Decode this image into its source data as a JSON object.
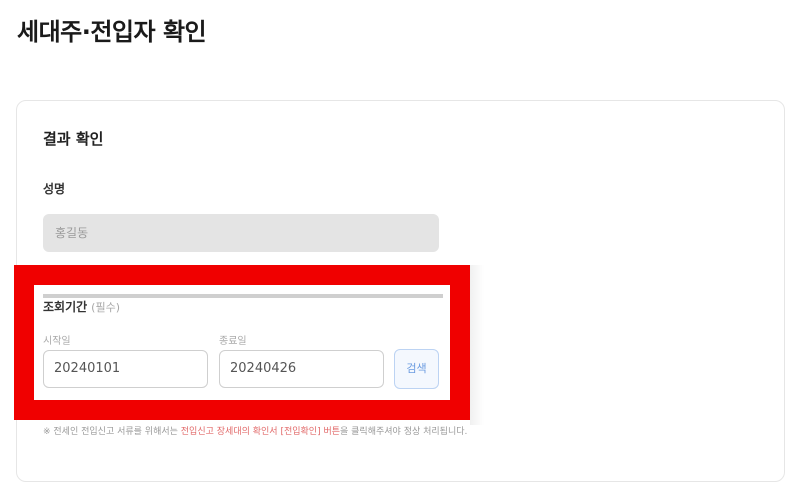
{
  "page": {
    "title": "세대주·전입자 확인"
  },
  "result": {
    "section_title": "결과 확인",
    "name_label": "성명",
    "name_value": "홍길동"
  },
  "period": {
    "label": "조회기간",
    "required": "(필수)",
    "start_label": "시작일",
    "start_value": "20240101",
    "end_label": "종료일",
    "end_value": "20240426",
    "search_label": "검색"
  },
  "notice": {
    "prefix": "※ 전세인 전입신고 서류를 위해서는",
    "highlight": "전입신고 장세대의 확인서 [전입확인] 버튼",
    "suffix": "을 클릭해주셔야 정상 처리됩니다."
  },
  "colors": {
    "highlight_border": "#f00000",
    "search_button": "#6a9be0"
  }
}
